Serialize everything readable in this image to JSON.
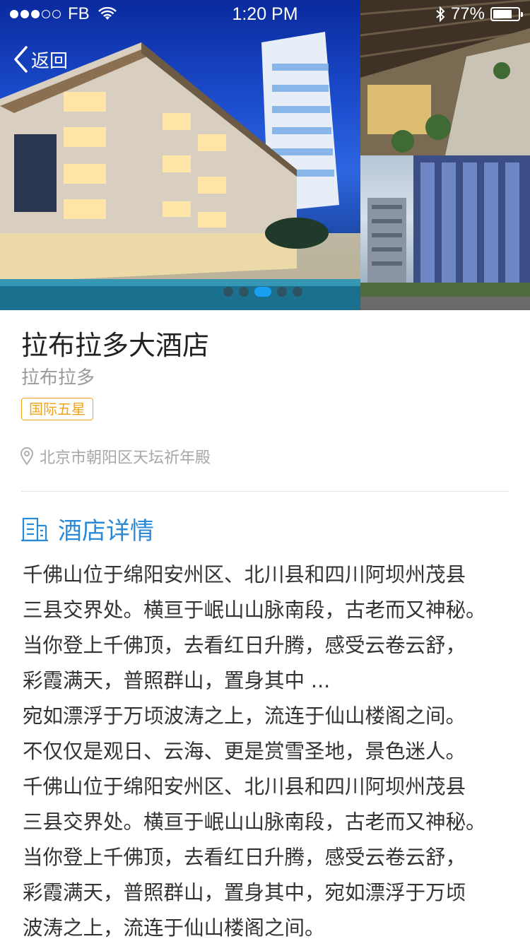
{
  "status_bar": {
    "carrier": "FB",
    "time": "1:20 PM",
    "battery": "77%",
    "battery_level": 0.77
  },
  "nav": {
    "back_label": "返回"
  },
  "gallery": {
    "page_count": 5,
    "active_index": 2
  },
  "hotel": {
    "name": "拉布拉多大酒店",
    "subtitle": "拉布拉多",
    "badge": "国际五星",
    "address": "北京市朝阳区天坛祈年殿"
  },
  "section": {
    "title": "酒店详情"
  },
  "description": "千佛山位于绵阳安州区、北川县和四川阿坝州茂县\n三县交界处。横亘于岷山山脉南段，古老而又神秘。\n当你登上千佛顶，去看红日升腾，感受云卷云舒，\n彩霞满天，普照群山，置身其中 ...\n宛如漂浮于万顷波涛之上，流连于仙山楼阁之间。\n不仅仅是观日、云海、更是赏雪圣地，景色迷人。\n千佛山位于绵阳安州区、北川县和四川阿坝州茂县\n三县交界处。横亘于岷山山脉南段，古老而又神秘。\n当你登上千佛顶，去看红日升腾，感受云卷云舒，\n彩霞满天，普照群山，置身其中，宛如漂浮于万顷\n波涛之上，流连于仙山楼阁之间。",
  "colors": {
    "accent": "#2b8ad8",
    "badge": "#f0a317",
    "active_dot": "#1aa0f0"
  },
  "icons": {
    "back": "chevron-left-icon",
    "location": "location-pin-icon",
    "hotel": "building-icon",
    "wifi": "wifi-icon",
    "bluetooth": "bluetooth-icon"
  }
}
